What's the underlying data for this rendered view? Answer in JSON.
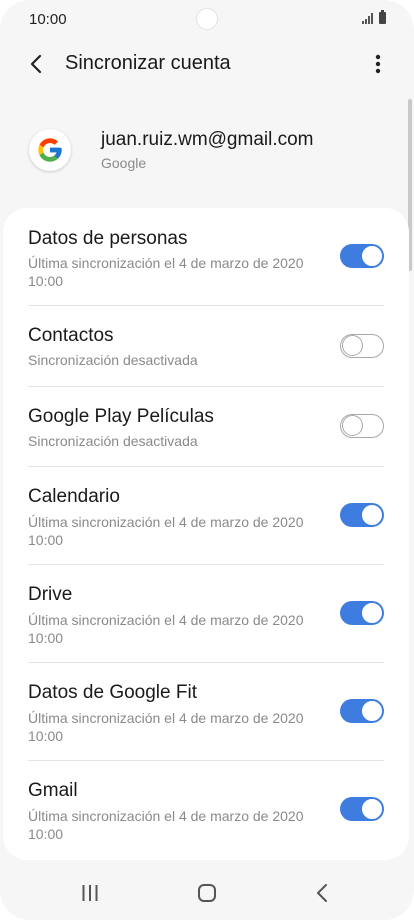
{
  "status_bar": {
    "time": "10:00"
  },
  "app_bar": {
    "title": "Sincronizar cuenta"
  },
  "account": {
    "email": "juan.ruiz.wm@gmail.com",
    "type": "Google",
    "logo_letter": "G"
  },
  "sync_items": [
    {
      "title": "Datos de personas",
      "subtitle": "Última sincronización el 4 de marzo de 2020 10:00",
      "enabled": true
    },
    {
      "title": "Contactos",
      "subtitle": "Sincronización desactivada",
      "enabled": false
    },
    {
      "title": "Google Play Películas",
      "subtitle": "Sincronización desactivada",
      "enabled": false
    },
    {
      "title": "Calendario",
      "subtitle": "Última sincronización el 4 de marzo de 2020 10:00",
      "enabled": true
    },
    {
      "title": "Drive",
      "subtitle": "Última sincronización el 4 de marzo de 2020 10:00",
      "enabled": true
    },
    {
      "title": "Datos de Google Fit",
      "subtitle": "Última sincronización el 4 de marzo de 2020 10:00",
      "enabled": true
    },
    {
      "title": "Gmail",
      "subtitle": "Última sincronización el 4 de marzo de 2020 10:00",
      "enabled": true
    }
  ],
  "colors": {
    "toggle_on": "#3e7ce0",
    "toggle_off_border": "#a8a8a8",
    "background": "#f6f6f6"
  }
}
